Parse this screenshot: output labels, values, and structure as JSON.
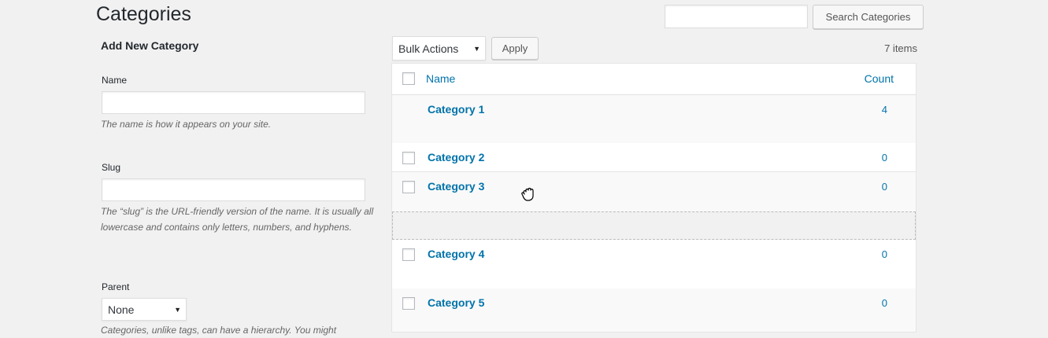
{
  "page": {
    "title": "Categories"
  },
  "search": {
    "button_label": "Search Categories",
    "value": ""
  },
  "form": {
    "heading": "Add New Category",
    "name": {
      "label": "Name",
      "value": "",
      "description": "The name is how it appears on your site."
    },
    "slug": {
      "label": "Slug",
      "value": "",
      "description": "The “slug” is the URL-friendly version of the name. It is usually all lowercase and contains only letters, numbers, and hyphens."
    },
    "parent": {
      "label": "Parent",
      "selected": "None",
      "description": "Categories, unlike tags, can have a hierarchy. You might"
    }
  },
  "toolbar": {
    "bulk_actions": "Bulk Actions",
    "apply_label": "Apply",
    "items_count": "7 items"
  },
  "table": {
    "columns": {
      "name": "Name",
      "count": "Count"
    },
    "rows": [
      {
        "name": "Category 1",
        "count": "4"
      },
      {
        "name": "Category 2",
        "count": "0"
      },
      {
        "name": "Category 3",
        "count": "0"
      },
      {
        "name": "Category 4",
        "count": "0"
      },
      {
        "name": "Category 5",
        "count": "0"
      }
    ]
  },
  "colors": {
    "link": "#0073aa",
    "background": "#f1f1f1",
    "heading": "#23282d"
  },
  "icons": {
    "cursor": "grab-hand-cursor-icon",
    "dropdown": "caret-down-icon"
  }
}
